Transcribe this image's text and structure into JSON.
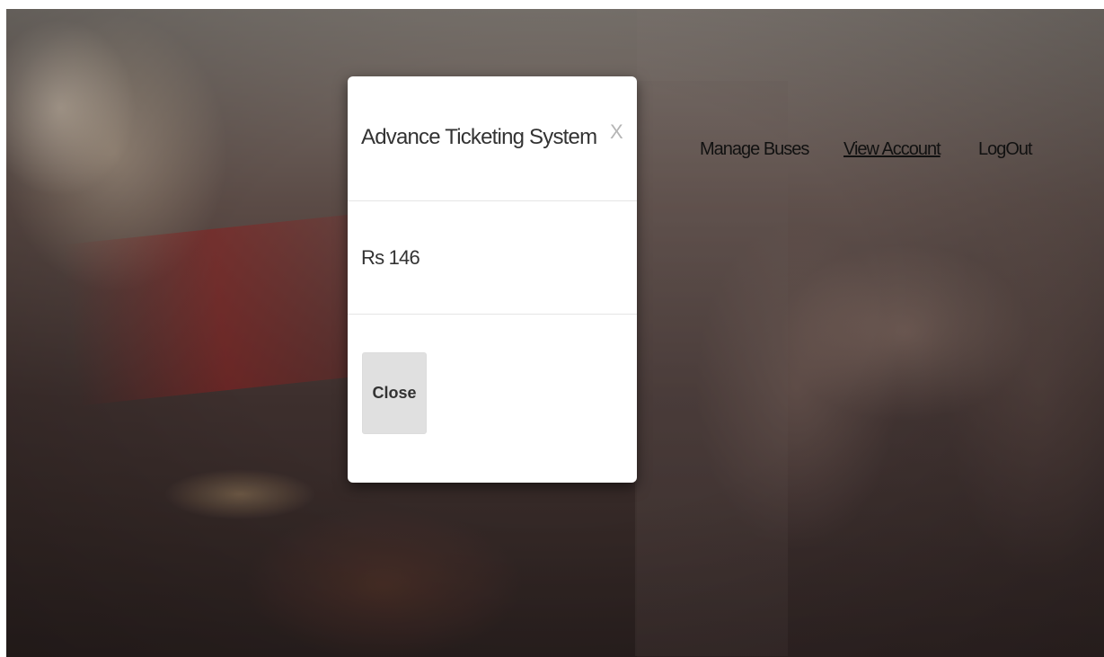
{
  "nav": {
    "items": [
      {
        "label": "Manage Buses",
        "active": false
      },
      {
        "label": "View Account",
        "active": true
      },
      {
        "label": "LogOut",
        "active": false
      }
    ]
  },
  "modal": {
    "title": "Advance Ticketing System",
    "close_x": "X",
    "body_text": "Rs 146",
    "close_button_label": "Close"
  }
}
